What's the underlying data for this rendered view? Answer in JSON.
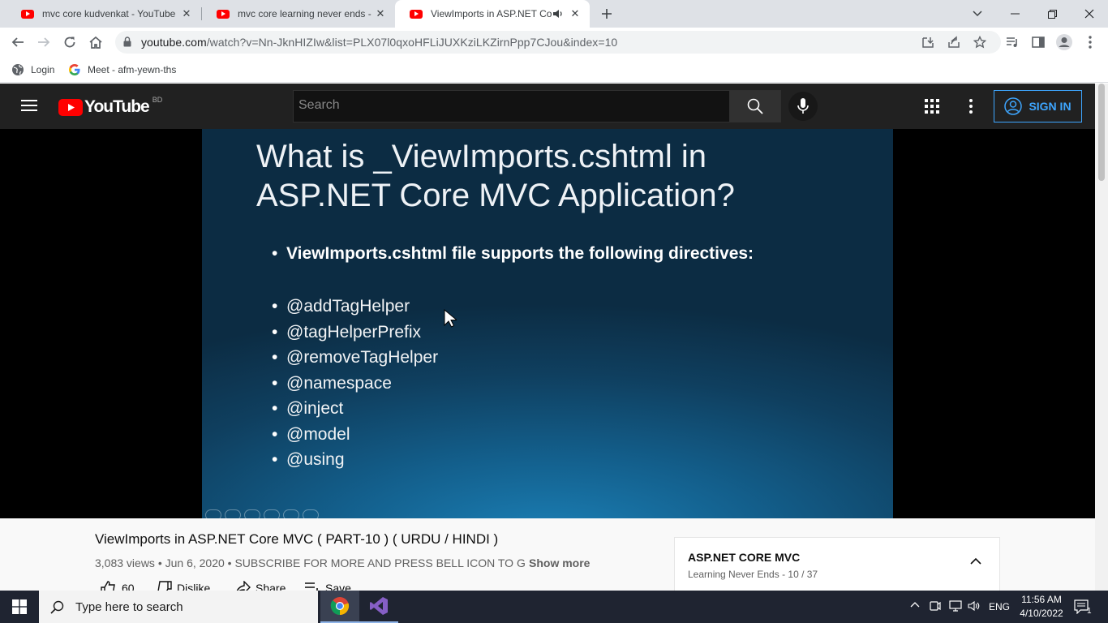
{
  "browser": {
    "tabs": [
      {
        "title": "mvc core kudvenkat - YouTube",
        "active": false
      },
      {
        "title": "mvc core learning never ends - Yo",
        "active": false
      },
      {
        "title": "ViewImports in ASP.NET Cor",
        "active": true
      }
    ],
    "url_host": "youtube.com",
    "url_path": "/watch?v=Nn-JknHIZIw&list=PLX07l0qxoHFLiJUXKziLKZirnPpp7CJou&index=10",
    "bookmarks": [
      {
        "label": "Login",
        "icon": "globe-icon"
      },
      {
        "label": "Meet - afm-yewn-ths",
        "icon": "google-icon"
      }
    ]
  },
  "youtube": {
    "logo_text": "YouTube",
    "country_code": "BD",
    "search_placeholder": "Search",
    "sign_in_label": "SIGN IN",
    "brand_color": "#ff0000",
    "accent_color": "#3ea6ff"
  },
  "slide": {
    "title_line1": "What is _ViewImports.cshtml in",
    "title_line2": "ASP.NET Core MVC Application?",
    "lead": "ViewImports.cshtml file supports the following directives:",
    "bullet_char": "•",
    "directives": [
      "@addTagHelper",
      "@tagHelperPrefix",
      "@removeTagHelper",
      "@namespace",
      "@inject",
      "@model",
      "@using"
    ]
  },
  "video": {
    "title": "ViewImports in ASP.NET Core MVC ( PART-10 ) ( URDU / HINDI )",
    "meta": "3,083 views • Jun 6, 2020 • SUBSCRIBE FOR MORE AND PRESS BELL ICON TO GET LATEST UPDATES",
    "show_more": "Show more",
    "actions": {
      "like_count": "60",
      "dislike": "Dislike",
      "share": "Share",
      "save": "Save"
    }
  },
  "playlist": {
    "title": "ASP.NET CORE MVC",
    "subtitle": "Learning Never Ends - 10 / 37"
  },
  "taskbar": {
    "search_placeholder": "Type here to search",
    "language": "ENG",
    "time": "11:56 AM",
    "date": "4/10/2022",
    "notification_count": "1"
  }
}
